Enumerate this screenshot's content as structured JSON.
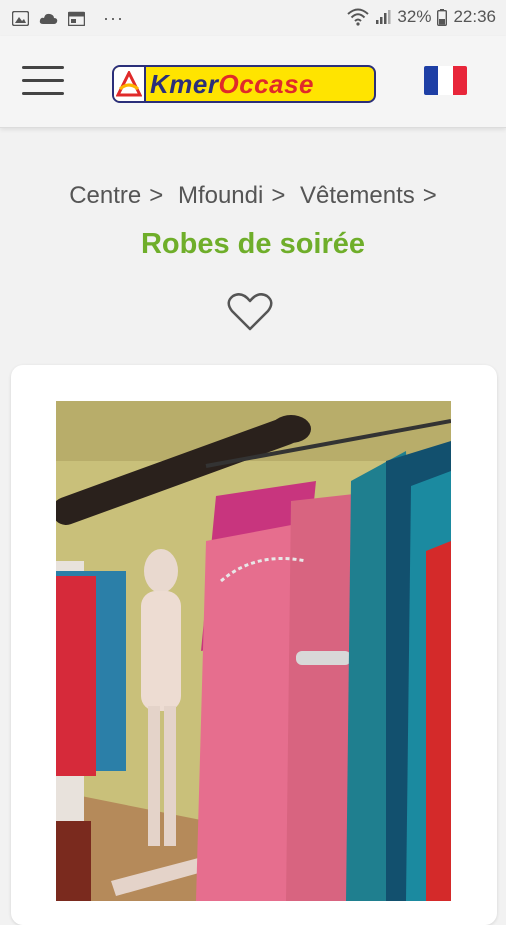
{
  "status_bar": {
    "battery": "32%",
    "time": "22:36",
    "overflow": "···"
  },
  "header": {
    "logo_text_part1": "Kmer",
    "logo_text_part2": "Occase",
    "language_flag": "fr"
  },
  "breadcrumb": {
    "items": [
      "Centre",
      "Mfoundi",
      "Vêtements"
    ],
    "separator": ">"
  },
  "page": {
    "title": "Robes de soirée"
  },
  "colors": {
    "title_green": "#6fae2a",
    "logo_yellow": "#ffe400",
    "logo_blue": "#2b2f7a",
    "logo_red": "#e02a2a",
    "flag_blue": "#1e3fa5",
    "flag_red": "#e8263a"
  },
  "icons": {
    "menu": "hamburger-menu-icon",
    "favorite": "heart-outline-icon"
  }
}
